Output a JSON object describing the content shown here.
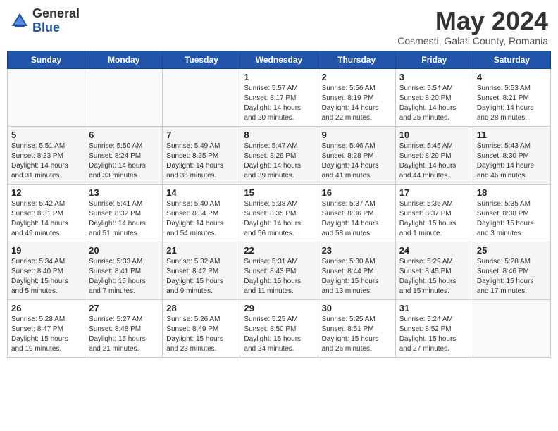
{
  "header": {
    "logo_general": "General",
    "logo_blue": "Blue",
    "month": "May 2024",
    "location": "Cosmesti, Galati County, Romania"
  },
  "days_of_week": [
    "Sunday",
    "Monday",
    "Tuesday",
    "Wednesday",
    "Thursday",
    "Friday",
    "Saturday"
  ],
  "weeks": [
    [
      {
        "day": "",
        "info": ""
      },
      {
        "day": "",
        "info": ""
      },
      {
        "day": "",
        "info": ""
      },
      {
        "day": "1",
        "info": "Sunrise: 5:57 AM\nSunset: 8:17 PM\nDaylight: 14 hours\nand 20 minutes."
      },
      {
        "day": "2",
        "info": "Sunrise: 5:56 AM\nSunset: 8:19 PM\nDaylight: 14 hours\nand 22 minutes."
      },
      {
        "day": "3",
        "info": "Sunrise: 5:54 AM\nSunset: 8:20 PM\nDaylight: 14 hours\nand 25 minutes."
      },
      {
        "day": "4",
        "info": "Sunrise: 5:53 AM\nSunset: 8:21 PM\nDaylight: 14 hours\nand 28 minutes."
      }
    ],
    [
      {
        "day": "5",
        "info": "Sunrise: 5:51 AM\nSunset: 8:23 PM\nDaylight: 14 hours\nand 31 minutes."
      },
      {
        "day": "6",
        "info": "Sunrise: 5:50 AM\nSunset: 8:24 PM\nDaylight: 14 hours\nand 33 minutes."
      },
      {
        "day": "7",
        "info": "Sunrise: 5:49 AM\nSunset: 8:25 PM\nDaylight: 14 hours\nand 36 minutes."
      },
      {
        "day": "8",
        "info": "Sunrise: 5:47 AM\nSunset: 8:26 PM\nDaylight: 14 hours\nand 39 minutes."
      },
      {
        "day": "9",
        "info": "Sunrise: 5:46 AM\nSunset: 8:28 PM\nDaylight: 14 hours\nand 41 minutes."
      },
      {
        "day": "10",
        "info": "Sunrise: 5:45 AM\nSunset: 8:29 PM\nDaylight: 14 hours\nand 44 minutes."
      },
      {
        "day": "11",
        "info": "Sunrise: 5:43 AM\nSunset: 8:30 PM\nDaylight: 14 hours\nand 46 minutes."
      }
    ],
    [
      {
        "day": "12",
        "info": "Sunrise: 5:42 AM\nSunset: 8:31 PM\nDaylight: 14 hours\nand 49 minutes."
      },
      {
        "day": "13",
        "info": "Sunrise: 5:41 AM\nSunset: 8:32 PM\nDaylight: 14 hours\nand 51 minutes."
      },
      {
        "day": "14",
        "info": "Sunrise: 5:40 AM\nSunset: 8:34 PM\nDaylight: 14 hours\nand 54 minutes."
      },
      {
        "day": "15",
        "info": "Sunrise: 5:38 AM\nSunset: 8:35 PM\nDaylight: 14 hours\nand 56 minutes."
      },
      {
        "day": "16",
        "info": "Sunrise: 5:37 AM\nSunset: 8:36 PM\nDaylight: 14 hours\nand 58 minutes."
      },
      {
        "day": "17",
        "info": "Sunrise: 5:36 AM\nSunset: 8:37 PM\nDaylight: 15 hours\nand 1 minute."
      },
      {
        "day": "18",
        "info": "Sunrise: 5:35 AM\nSunset: 8:38 PM\nDaylight: 15 hours\nand 3 minutes."
      }
    ],
    [
      {
        "day": "19",
        "info": "Sunrise: 5:34 AM\nSunset: 8:40 PM\nDaylight: 15 hours\nand 5 minutes."
      },
      {
        "day": "20",
        "info": "Sunrise: 5:33 AM\nSunset: 8:41 PM\nDaylight: 15 hours\nand 7 minutes."
      },
      {
        "day": "21",
        "info": "Sunrise: 5:32 AM\nSunset: 8:42 PM\nDaylight: 15 hours\nand 9 minutes."
      },
      {
        "day": "22",
        "info": "Sunrise: 5:31 AM\nSunset: 8:43 PM\nDaylight: 15 hours\nand 11 minutes."
      },
      {
        "day": "23",
        "info": "Sunrise: 5:30 AM\nSunset: 8:44 PM\nDaylight: 15 hours\nand 13 minutes."
      },
      {
        "day": "24",
        "info": "Sunrise: 5:29 AM\nSunset: 8:45 PM\nDaylight: 15 hours\nand 15 minutes."
      },
      {
        "day": "25",
        "info": "Sunrise: 5:28 AM\nSunset: 8:46 PM\nDaylight: 15 hours\nand 17 minutes."
      }
    ],
    [
      {
        "day": "26",
        "info": "Sunrise: 5:28 AM\nSunset: 8:47 PM\nDaylight: 15 hours\nand 19 minutes."
      },
      {
        "day": "27",
        "info": "Sunrise: 5:27 AM\nSunset: 8:48 PM\nDaylight: 15 hours\nand 21 minutes."
      },
      {
        "day": "28",
        "info": "Sunrise: 5:26 AM\nSunset: 8:49 PM\nDaylight: 15 hours\nand 23 minutes."
      },
      {
        "day": "29",
        "info": "Sunrise: 5:25 AM\nSunset: 8:50 PM\nDaylight: 15 hours\nand 24 minutes."
      },
      {
        "day": "30",
        "info": "Sunrise: 5:25 AM\nSunset: 8:51 PM\nDaylight: 15 hours\nand 26 minutes."
      },
      {
        "day": "31",
        "info": "Sunrise: 5:24 AM\nSunset: 8:52 PM\nDaylight: 15 hours\nand 27 minutes."
      },
      {
        "day": "",
        "info": ""
      }
    ]
  ]
}
